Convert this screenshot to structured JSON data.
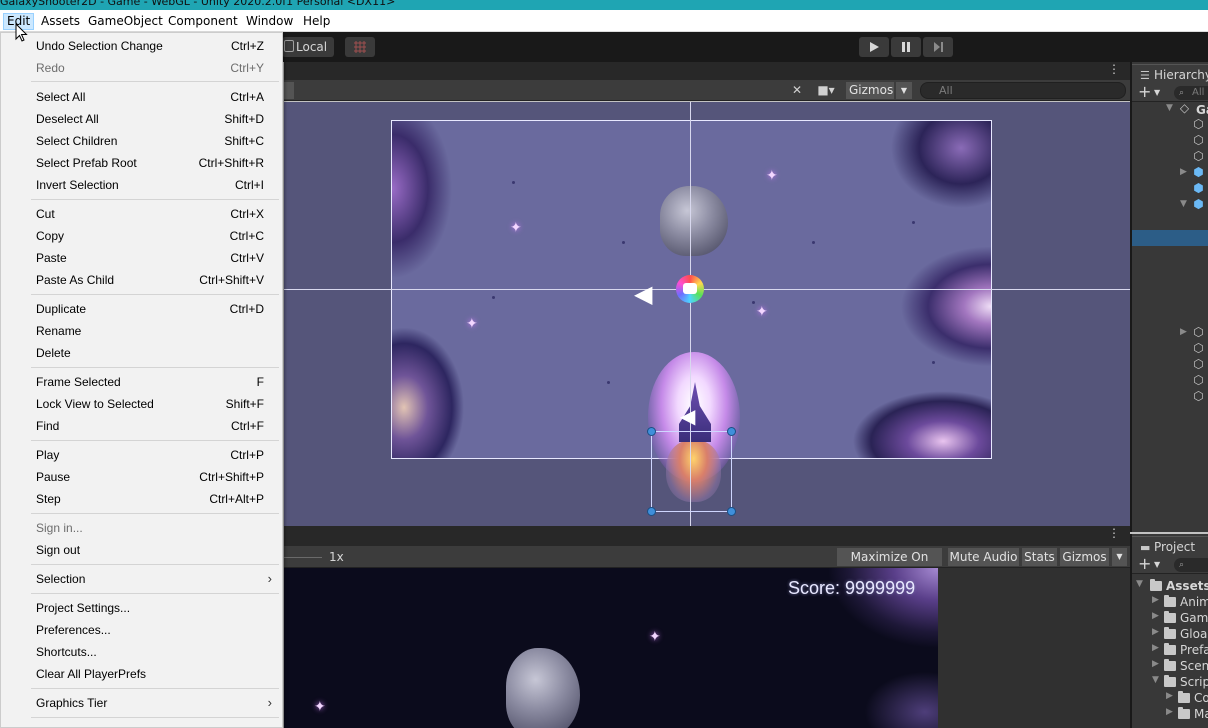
{
  "window_title": "GalaxyShooter2D - Game - WebGL - Unity 2020.2.0f1 Personal <DX11>",
  "menubar": {
    "items": [
      "Edit",
      "Assets",
      "GameObject",
      "Component",
      "Window",
      "Help"
    ]
  },
  "toolbar": {
    "pivot_label": "Local"
  },
  "edit_menu": {
    "items": [
      {
        "label": "Undo Selection Change",
        "shortcut": "Ctrl+Z"
      },
      {
        "label": "Redo",
        "shortcut": "Ctrl+Y"
      },
      {
        "label": "Select All",
        "shortcut": "Ctrl+A"
      },
      {
        "label": "Deselect All",
        "shortcut": "Shift+D"
      },
      {
        "label": "Select Children",
        "shortcut": "Shift+C"
      },
      {
        "label": "Select Prefab Root",
        "shortcut": "Ctrl+Shift+R"
      },
      {
        "label": "Invert Selection",
        "shortcut": "Ctrl+I"
      },
      {
        "label": "Cut",
        "shortcut": "Ctrl+X"
      },
      {
        "label": "Copy",
        "shortcut": "Ctrl+C"
      },
      {
        "label": "Paste",
        "shortcut": "Ctrl+V"
      },
      {
        "label": "Paste As Child",
        "shortcut": "Ctrl+Shift+V"
      },
      {
        "label": "Duplicate",
        "shortcut": "Ctrl+D"
      },
      {
        "label": "Rename",
        "shortcut": ""
      },
      {
        "label": "Delete",
        "shortcut": ""
      },
      {
        "label": "Frame Selected",
        "shortcut": "F"
      },
      {
        "label": "Lock View to Selected",
        "shortcut": "Shift+F"
      },
      {
        "label": "Find",
        "shortcut": "Ctrl+F"
      },
      {
        "label": "Play",
        "shortcut": "Ctrl+P"
      },
      {
        "label": "Pause",
        "shortcut": "Ctrl+Shift+P"
      },
      {
        "label": "Step",
        "shortcut": "Ctrl+Alt+P"
      },
      {
        "label": "Sign in...",
        "shortcut": ""
      },
      {
        "label": "Sign out",
        "shortcut": ""
      },
      {
        "label": "Selection",
        "shortcut": ""
      },
      {
        "label": "Project Settings...",
        "shortcut": ""
      },
      {
        "label": "Preferences...",
        "shortcut": ""
      },
      {
        "label": "Shortcuts...",
        "shortcut": ""
      },
      {
        "label": "Clear All PlayerPrefs",
        "shortcut": ""
      },
      {
        "label": "Graphics Tier",
        "shortcut": ""
      }
    ]
  },
  "scene": {
    "gizmos_label": "Gizmos",
    "search_placeholder": "All"
  },
  "game": {
    "scale_label": "1x",
    "maximize_label": "Maximize On Play",
    "mute_label": "Mute Audio",
    "stats_label": "Stats",
    "gizmos_label": "Gizmos",
    "score_text": "Score: 9999999"
  },
  "hierarchy": {
    "title": "Hierarchy",
    "search_placeholder": "All",
    "root_label": "Ga"
  },
  "project": {
    "title": "Project",
    "folders": [
      "Assets",
      "Anima",
      "Game",
      "Gloab",
      "Prefa",
      "Scen",
      "Scrip",
      "Co",
      "Ma"
    ]
  },
  "colors": {
    "title_bar": "#1fa5b3",
    "selection": "#2c5d87",
    "scene_bg": "#55557a"
  }
}
